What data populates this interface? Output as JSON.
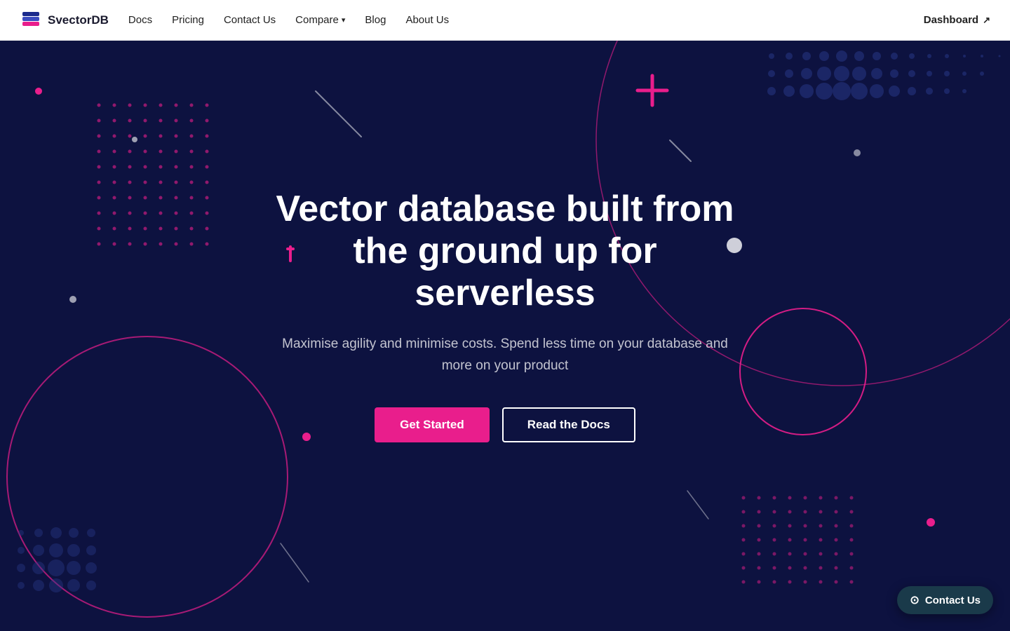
{
  "brand": {
    "name": "SvectorDB",
    "logo_alt": "SvectorDB logo"
  },
  "nav": {
    "links": [
      {
        "label": "Docs",
        "name": "docs"
      },
      {
        "label": "Pricing",
        "name": "pricing"
      },
      {
        "label": "Contact Us",
        "name": "contact"
      },
      {
        "label": "Compare",
        "name": "compare",
        "has_dropdown": true
      },
      {
        "label": "Blog",
        "name": "blog"
      },
      {
        "label": "About Us",
        "name": "about"
      }
    ],
    "dashboard": {
      "label": "Dashboard"
    }
  },
  "hero": {
    "title": "Vector database built from the ground up for serverless",
    "subtitle": "Maximise agility and minimise costs. Spend less time on your database and more on your product",
    "cta_primary": "Get Started",
    "cta_secondary": "Read the Docs"
  },
  "contact_float": {
    "label": "Contact Us"
  },
  "colors": {
    "pink": "#e91e8c",
    "dark_bg": "#0d1240",
    "nav_bg": "#ffffff"
  }
}
